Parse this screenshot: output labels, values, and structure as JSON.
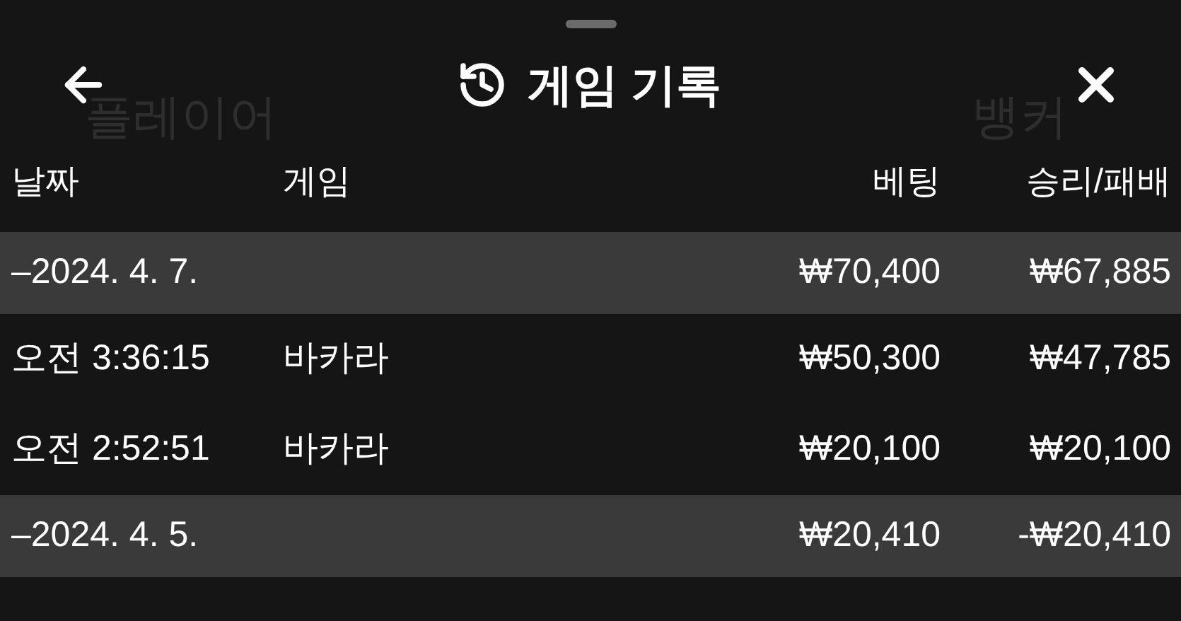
{
  "background": {
    "labels": [
      "플레이어",
      "뱅커"
    ]
  },
  "header": {
    "title": "게임 기록"
  },
  "table": {
    "columns": [
      "날짜",
      "게임",
      "베팅",
      "승리/패배"
    ],
    "rows": [
      {
        "kind": "date",
        "date": "–2024. 4. 7.",
        "game": "",
        "bet": "₩70,400",
        "result": "₩67,885"
      },
      {
        "kind": "entry",
        "date": "오전 3:36:15",
        "game": "바카라",
        "bet": "₩50,300",
        "result": "₩47,785"
      },
      {
        "kind": "entry",
        "date": "오전 2:52:51",
        "game": "바카라",
        "bet": "₩20,100",
        "result": "₩20,100"
      },
      {
        "kind": "date",
        "date": "–2024. 4. 5.",
        "game": "",
        "bet": "₩20,410",
        "result": "-₩20,410"
      }
    ]
  }
}
